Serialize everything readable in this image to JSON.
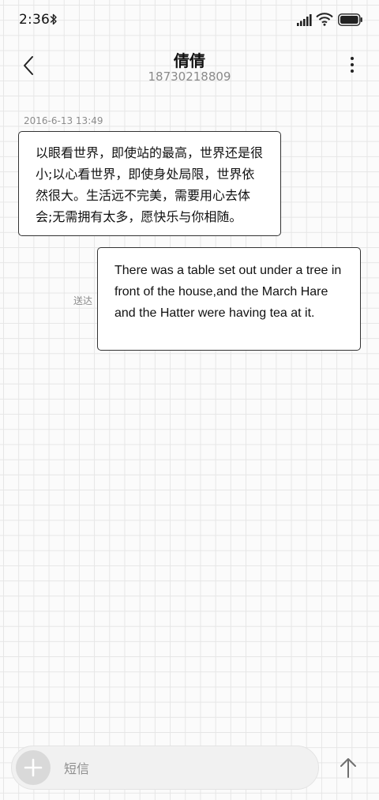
{
  "status_bar": {
    "time": "2:36",
    "icons": [
      "bluetooth-icon",
      "signal-icon",
      "wifi-icon",
      "battery-icon"
    ]
  },
  "header": {
    "contact_name": "倩倩",
    "contact_number": "18730218809",
    "icons": [
      "back-arrow-icon",
      "more-vertical-icon"
    ]
  },
  "conversation": {
    "timestamp": "2016-6-13 13:49",
    "messages": [
      {
        "direction": "incoming",
        "text": "以眼看世界，即使站的最高，世界还是很小;以心看世界，即使身处局限，世界依然很大。生活远不完美，需要用心去体会;无需拥有太多，愿快乐与你相随。"
      },
      {
        "direction": "outgoing",
        "text": "There was a table set out under a tree in front of the house,and the March Hare and the Hatter were having tea at it.",
        "status": "送达"
      }
    ]
  },
  "composer": {
    "placeholder": "短信",
    "value": "",
    "icons": [
      "plus-icon",
      "send-arrow-icon"
    ]
  },
  "colors": {
    "background": "#fbfbfb",
    "grid_line": "#e6e6e6",
    "bubble_border": "#333333",
    "muted_text": "#8c8c8c",
    "composer_bg": "#f1f1f1",
    "add_button_bg": "#d9d9d9"
  }
}
